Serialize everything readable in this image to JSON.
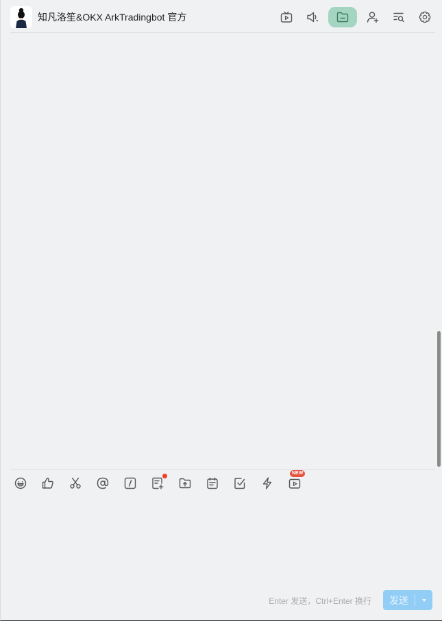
{
  "chat": {
    "title": "知凡洛笙&OKX ArkTradingbot 官方",
    "avatar_icon": "person-avatar-icon"
  },
  "header_tools": [
    {
      "name": "live-stream-icon"
    },
    {
      "name": "announcement-icon"
    },
    {
      "name": "folder-icon",
      "active": true
    },
    {
      "name": "add-member-icon"
    },
    {
      "name": "search-history-icon"
    },
    {
      "name": "settings-gear-icon"
    }
  ],
  "toolbar": {
    "tools": [
      {
        "name": "emoji-icon"
      },
      {
        "name": "like-icon"
      },
      {
        "name": "scissors-icon"
      },
      {
        "name": "at-mention-icon"
      },
      {
        "name": "slash-command-icon"
      },
      {
        "name": "note-add-icon",
        "has_dot": true
      },
      {
        "name": "folder-upload-icon"
      },
      {
        "name": "calendar-icon"
      },
      {
        "name": "task-check-icon"
      },
      {
        "name": "lightning-icon"
      },
      {
        "name": "video-icon",
        "badge": "NEW"
      }
    ],
    "new_badge": "NEW"
  },
  "composer": {
    "hint": "Enter 发送，Ctrl+Enter 换行",
    "send_label": "发送"
  },
  "colors": {
    "background": "#f0f1f3",
    "active_tool": "#a3d5c1",
    "send_button": "#92cdf6",
    "badge_red": "#e5533d"
  }
}
